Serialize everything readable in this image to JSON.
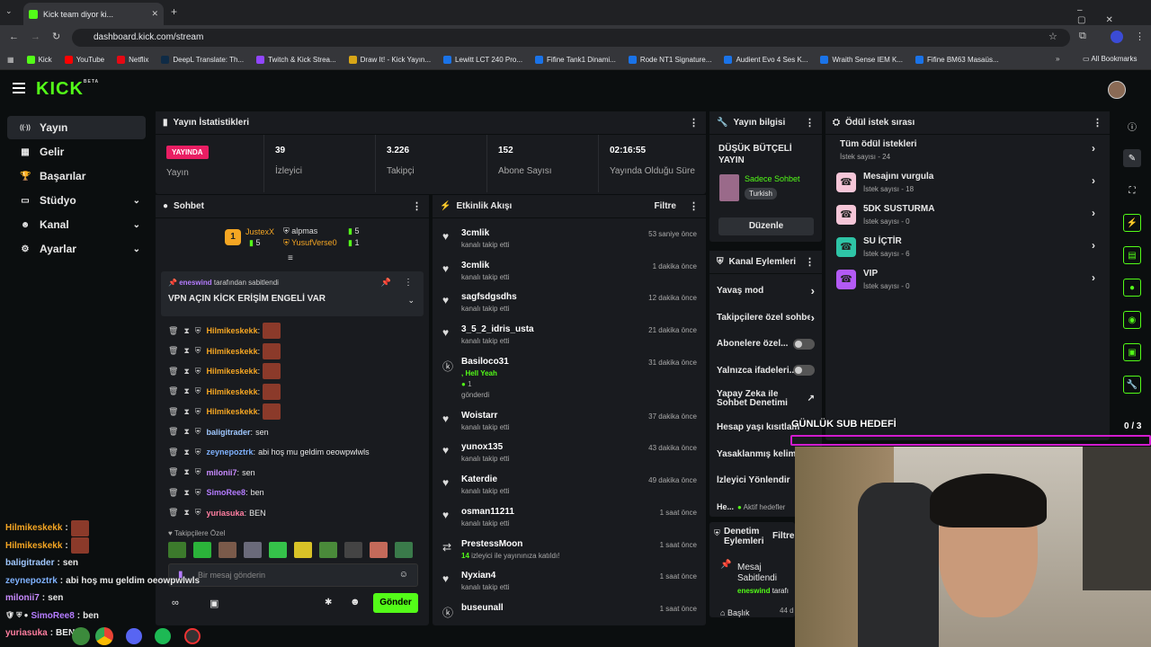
{
  "browser": {
    "tab_title": "Kick team diyor ki...",
    "url": "dashboard.kick.com/stream",
    "bookmarks": [
      "Kick",
      "YouTube",
      "Netflix",
      "DeepL Translate: Th...",
      "Twitch & Kick Strea...",
      "Draw It! - Kick Yayın...",
      "Lewitt LCT 240 Pro...",
      "Fifine Tank1 Dinami...",
      "Rode NT1 Signature...",
      "Audient Evo 4 Ses K...",
      "Wraith Sense IEM K...",
      "Fifine BM63 Masaüs..."
    ],
    "all_bookmarks": "All Bookmarks"
  },
  "logo": {
    "text": "KICK",
    "beta": "BETA"
  },
  "nav": [
    {
      "label": "Yayın",
      "icon": "broadcast-icon"
    },
    {
      "label": "Gelir",
      "icon": "revenue-icon"
    },
    {
      "label": "Başarılar",
      "icon": "trophy-icon"
    },
    {
      "label": "Stüdyo",
      "icon": "studio-icon"
    },
    {
      "label": "Kanal",
      "icon": "channel-icon"
    },
    {
      "label": "Ayarlar",
      "icon": "gear-icon"
    }
  ],
  "stats": {
    "title": "Yayın İstatistikleri",
    "live_badge": "YAYINDA",
    "stream_label": "Yayın",
    "items": [
      {
        "value": "39",
        "label": "İzleyici"
      },
      {
        "value": "3.226",
        "label": "Takipçi"
      },
      {
        "value": "152",
        "label": "Abone Sayısı"
      },
      {
        "value": "02:16:55",
        "label": "Yayında Olduğu Süre"
      }
    ]
  },
  "chat": {
    "title": "Sohbet",
    "top": [
      {
        "rank": "1",
        "name": "JustexX",
        "count": "5"
      },
      {
        "name": "alpmas",
        "count": "5"
      },
      {
        "name": "YusufVerse0",
        "count": "1"
      }
    ],
    "pinned_by": "eneswind",
    "pinned_suffix": "tarafından sabitlendi",
    "pinned_text": "VPN AÇIN KİCK ERİŞİM ENGELİ VAR",
    "messages": [
      {
        "user": "Hilmikeskekk",
        "text": "",
        "color": "#f5a623"
      },
      {
        "user": "Hilmikeskekk",
        "text": "",
        "color": "#f5a623"
      },
      {
        "user": "Hilmikeskekk",
        "text": "",
        "color": "#f5a623"
      },
      {
        "user": "Hilmikeskekk",
        "text": "",
        "color": "#f5a623"
      },
      {
        "user": "Hilmikeskekk",
        "text": "",
        "color": "#f5a623"
      },
      {
        "user": "baligitrader",
        "text": "sen",
        "color": "#a0c8ff"
      },
      {
        "user": "zeynepoztrk",
        "text": "abi hoş mu geldim oeowpwlwls",
        "color": "#7fb2ff"
      },
      {
        "user": "milonii7",
        "text": "sen",
        "color": "#c88bff"
      },
      {
        "user": "SimoRee8",
        "text": "ben",
        "color": "#b57cff"
      },
      {
        "user": "yuriasuka",
        "text": "BEN",
        "color": "#ff7ea0"
      }
    ],
    "followers_only": "Takipçilere Özel",
    "input_placeholder": "Bir mesaj gönderin",
    "send_label": "Gönder"
  },
  "activity": {
    "title": "Etkinlik Akışı",
    "filter": "Filtre",
    "items": [
      {
        "name": "3cmlik",
        "sub": "kanalı takip etti",
        "time": "53 saniye önce"
      },
      {
        "name": "3cmlik",
        "sub": "kanalı takip etti",
        "time": "1 dakika önce"
      },
      {
        "name": "sagfsdgsdhs",
        "sub": "kanalı takip etti",
        "time": "12 dakika önce"
      },
      {
        "name": "3_5_2_idris_usta",
        "sub": "kanalı takip etti",
        "time": "21 dakika önce"
      },
      {
        "name": "Basiloco31",
        "sub": "gönderdi",
        "extra": ", Hell Yeah",
        "kicks": "1",
        "time": "31 dakika önce"
      },
      {
        "name": "Woistarr",
        "sub": "kanalı takip etti",
        "time": "37 dakika önce"
      },
      {
        "name": "yunox135",
        "sub": "kanalı takip etti",
        "time": "43 dakika önce"
      },
      {
        "name": "Katerdie",
        "sub": "kanalı takip etti",
        "time": "49 dakika önce"
      },
      {
        "name": "osman11211",
        "sub": "kanalı takip etti",
        "time": "1 saat önce"
      },
      {
        "name": "PrestessMoon",
        "sub": "izleyici ile yayınınıza katıldı!",
        "count": "14",
        "time": "1 saat önce"
      },
      {
        "name": "Nyxian4",
        "sub": "kanalı takip etti",
        "time": "1 saat önce"
      },
      {
        "name": "buseunall",
        "sub": "",
        "time": "1 saat önce"
      }
    ]
  },
  "stream_info": {
    "title": "Yayın bilgisi",
    "stream_title": "DÜŞÜK BÜTÇELİ YAYIN",
    "category": "Sadece Sohbet",
    "tag": "Turkish",
    "edit": "Düzenle"
  },
  "channel_actions": {
    "title": "Kanal Eylemleri",
    "items": [
      {
        "label": "Yavaş mod",
        "type": "chevron"
      },
      {
        "label": "Takipçilere özel sohbe",
        "type": "chevron"
      },
      {
        "label": "Abonelere özel...",
        "type": "toggle"
      },
      {
        "label": "Yalnızca ifadeleri...",
        "type": "toggle"
      },
      {
        "label": "Yapay Zeka ile Sohbet Denetimi",
        "type": "link"
      },
      {
        "label": "Hesap yaşı kısıtlam",
        "type": "none"
      },
      {
        "label": "Yasaklanmış kelime",
        "type": "none"
      },
      {
        "label": "İzleyici Yönlendir",
        "type": "none"
      },
      {
        "label": "He...",
        "status": "Aktif hedefler",
        "type": "none"
      }
    ]
  },
  "moderation": {
    "title": "Denetim Eylemleri",
    "filter": "Filtre",
    "item_title": "Mesaj Sabitlendi",
    "item_user": "eneswind",
    "item_suffix": "tarafı",
    "next": "Başlık",
    "next_time": "44 d"
  },
  "rewards": {
    "title": "Ödül istek sırası",
    "all": {
      "name": "Tüm ödül istekleri",
      "count": "İstek sayısı - 24"
    },
    "items": [
      {
        "name": "Mesajını vurgula",
        "count": "İstek sayısı - 18",
        "color": "#f5c6d8"
      },
      {
        "name": "5DK SUSTURMA",
        "count": "İstek sayısı - 0",
        "color": "#f5c6d8"
      },
      {
        "name": "SU İÇTİR",
        "count": "İstek sayısı - 6",
        "color": "#2ec4a6"
      },
      {
        "name": "VIP",
        "count": "İstek sayısı - 0",
        "color": "#b35af5"
      }
    ]
  },
  "overlay": {
    "goal_title": "GÜNLÜK SUB HEDEFİ",
    "goal_count": "0 / 3",
    "lines": [
      {
        "user": "Hilmikeskekk",
        "text": "",
        "color": "#f5a623"
      },
      {
        "user": "Hilmikeskekk",
        "text": "",
        "color": "#f5a623"
      },
      {
        "user": "baligitrader",
        "text": "sen",
        "color": "#a0c8ff"
      },
      {
        "user": "zeynepoztrk",
        "text": "abi hoş mu geldim oeowpwlwls",
        "color": "#7fb2ff"
      },
      {
        "user": "milonii7",
        "text": "sen",
        "color": "#c88bff"
      },
      {
        "user": "SimoRee8",
        "text": "ben",
        "color": "#b57cff"
      },
      {
        "user": "yuriasuka",
        "text": "BEN",
        "color": "#ff7ea0"
      }
    ]
  },
  "colors": {
    "accent": "#53fc18",
    "live": "#e91e63",
    "panel": "#191b1f",
    "bg": "#0b0e0f"
  }
}
